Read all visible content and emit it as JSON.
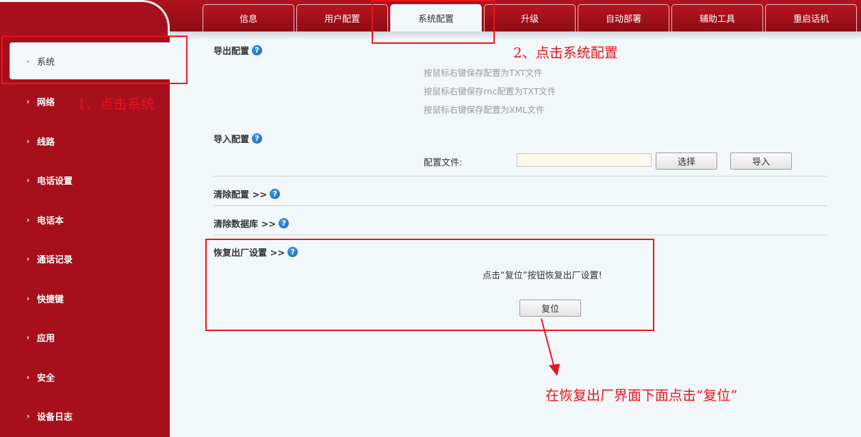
{
  "tabs": [
    {
      "label": "信息"
    },
    {
      "label": "用户配置"
    },
    {
      "label": "系统配置",
      "active": true
    },
    {
      "label": "升级"
    },
    {
      "label": "自动部署"
    },
    {
      "label": "辅助工具"
    },
    {
      "label": "重启话机"
    }
  ],
  "sidebar": {
    "items": [
      {
        "label": "系统",
        "active": true
      },
      {
        "label": "网络"
      },
      {
        "label": "线路"
      },
      {
        "label": "电话设置"
      },
      {
        "label": "电话本"
      },
      {
        "label": "通话记录"
      },
      {
        "label": "快捷键"
      },
      {
        "label": "应用"
      },
      {
        "label": "安全"
      },
      {
        "label": "设备日志"
      }
    ],
    "chevron": "›"
  },
  "export_config": {
    "title": "导出配置",
    "links": [
      "按鼠标右键保存配置为TXT文件",
      "按鼠标右键保存rnc配置为TXT文件",
      "按鼠标右键保存配置为XML文件"
    ]
  },
  "import_config": {
    "title": "导入配置",
    "file_label": "配置文件:",
    "file_value": "",
    "select_button": "选择",
    "import_button": "导入"
  },
  "clear_config": {
    "title": "清除配置 >>"
  },
  "clear_database": {
    "title": "清除数据库 >>"
  },
  "factory_reset": {
    "title": "恢复出厂设置 >>",
    "message": "点击“复位”按钮恢复出厂设置!",
    "reset_button": "复位"
  },
  "help_glyph": "?",
  "annotations": {
    "step1": "1、点击系统",
    "step2": "2、点击系统配置",
    "step3": "在恢复出厂界面下面点击“复位”"
  },
  "colors": {
    "brand_red": "#a70f1c",
    "annotation_red": "#e8141c",
    "help_blue": "#1f7dc8"
  }
}
